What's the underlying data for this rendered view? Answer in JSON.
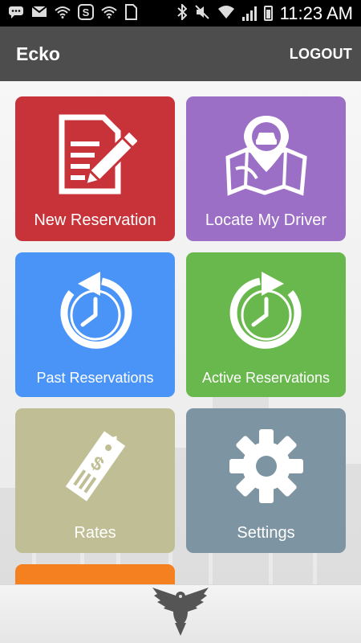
{
  "status_bar": {
    "time": "11:23 AM",
    "icons": [
      "chat-icon",
      "gmail-icon",
      "wifi-icon",
      "skype-icon",
      "wifi-icon",
      "sim-icon",
      "bluetooth-icon",
      "mute-icon",
      "wifi-signal-icon",
      "cell-signal-icon",
      "battery-icon"
    ]
  },
  "app_bar": {
    "title": "Ecko",
    "logout_label": "LOGOUT"
  },
  "tiles": [
    {
      "label": "New Reservation",
      "icon": "edit-document-icon",
      "color": "#c8333a"
    },
    {
      "label": "Locate My Driver",
      "icon": "map-pin-car-icon",
      "color": "#9c6fc6"
    },
    {
      "label": "Past Reservations",
      "icon": "clock-history-icon",
      "color": "#4a94f8"
    },
    {
      "label": "Active Reservations",
      "icon": "clock-forward-icon",
      "color": "#69b84e"
    },
    {
      "label": "Rates",
      "icon": "price-tag-icon",
      "color": "#bfbe94"
    },
    {
      "label": "Settings",
      "icon": "gear-icon",
      "color": "#7d94a2"
    },
    {
      "label": "",
      "icon": "",
      "color": "#f5801f"
    }
  ],
  "footer": {
    "logo": "eagle-logo-icon"
  }
}
